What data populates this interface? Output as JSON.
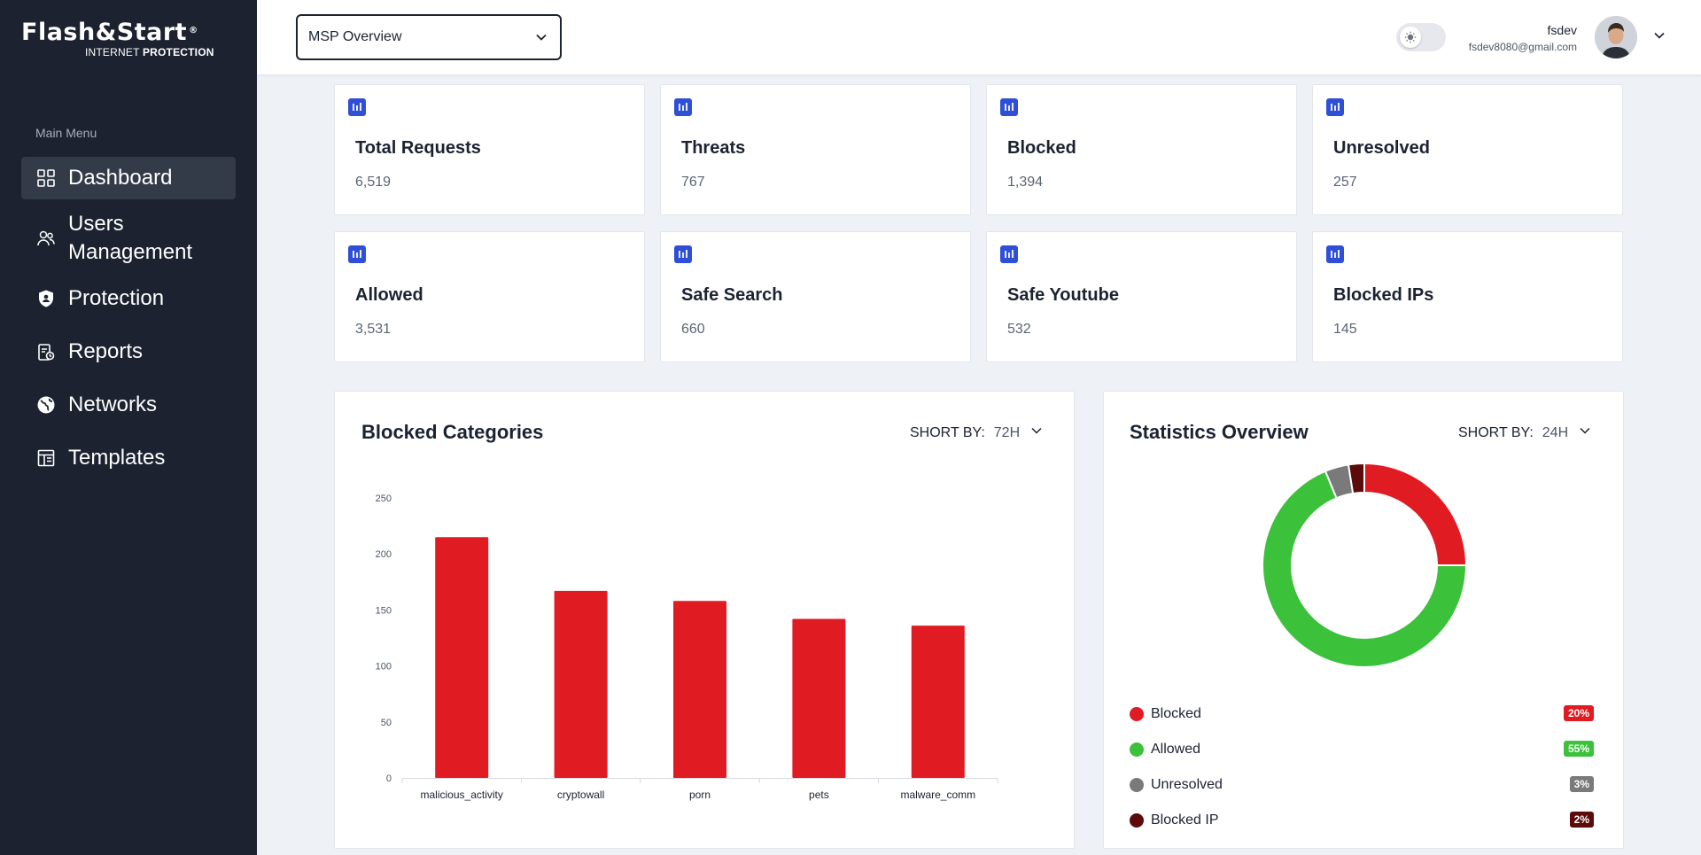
{
  "logo": {
    "brand": "Flash&Start",
    "reg": "®",
    "sub_light": "INTERNET",
    "sub_bold": "PROTECTION"
  },
  "sidebar": {
    "heading": "Main Menu",
    "items": [
      {
        "label": "Dashboard",
        "icon": "grid-icon",
        "active": true
      },
      {
        "label": "Users Management",
        "icon": "users-icon"
      },
      {
        "label": "Protection",
        "icon": "shield-icon"
      },
      {
        "label": "Reports",
        "icon": "report-icon"
      },
      {
        "label": "Networks",
        "icon": "globe-icon"
      },
      {
        "label": "Templates",
        "icon": "template-icon"
      }
    ]
  },
  "header": {
    "select_value": "MSP Overview",
    "theme_toggle_icon": "sun-icon",
    "user_name": "fsdev",
    "user_email": "fsdev8080@gmail.com"
  },
  "stats": [
    {
      "title": "Total Requests",
      "value": "6,519",
      "icon": "bar-chart-icon"
    },
    {
      "title": "Threats",
      "value": "767",
      "icon": "bar-chart-icon"
    },
    {
      "title": "Blocked",
      "value": "1,394",
      "icon": "bar-chart-icon"
    },
    {
      "title": "Unresolved",
      "value": "257",
      "icon": "bar-chart-icon"
    },
    {
      "title": "Allowed",
      "value": "3,531",
      "icon": "bar-chart-icon"
    },
    {
      "title": "Safe Search",
      "value": "660",
      "icon": "bar-chart-icon"
    },
    {
      "title": "Safe Youtube",
      "value": "532",
      "icon": "bar-chart-icon"
    },
    {
      "title": "Blocked IPs",
      "value": "145",
      "icon": "bar-chart-icon"
    }
  ],
  "blocked_panel": {
    "title": "Blocked Categories",
    "sort_label": "SHORT BY:",
    "sort_value": "72H"
  },
  "stats_panel": {
    "title": "Statistics Overview",
    "sort_label": "SHORT BY:",
    "sort_value": "24H",
    "legend": [
      {
        "label": "Blocked",
        "pct": "20%",
        "color": "#e11b22"
      },
      {
        "label": "Allowed",
        "pct": "55%",
        "color": "#3cc13b"
      },
      {
        "label": "Unresolved",
        "pct": "3%",
        "color": "#7a7a7a"
      },
      {
        "label": "Blocked IP",
        "pct": "2%",
        "color": "#5c0a0a"
      }
    ]
  },
  "colors": {
    "accent": "#2f4fd7",
    "bar": "#e11b22",
    "sidebar": "#1c2230"
  },
  "chart_data": [
    {
      "type": "bar",
      "title": "Blocked Categories",
      "categories": [
        "malicious_activity",
        "cryptowall",
        "porn",
        "pets",
        "malware_comm"
      ],
      "values": [
        215,
        167,
        158,
        142,
        136
      ],
      "ylim": [
        0,
        250
      ],
      "yticks": [
        0,
        50,
        100,
        150,
        200,
        250
      ],
      "color": "#e11b22",
      "grid": false
    },
    {
      "type": "pie",
      "title": "Statistics Overview",
      "donut": true,
      "categories": [
        "Blocked",
        "Allowed",
        "Unresolved",
        "Blocked IP"
      ],
      "values": [
        20,
        55,
        3,
        2
      ],
      "colors": [
        "#e11b22",
        "#3cc13b",
        "#7a7a7a",
        "#5c0a0a"
      ]
    }
  ]
}
